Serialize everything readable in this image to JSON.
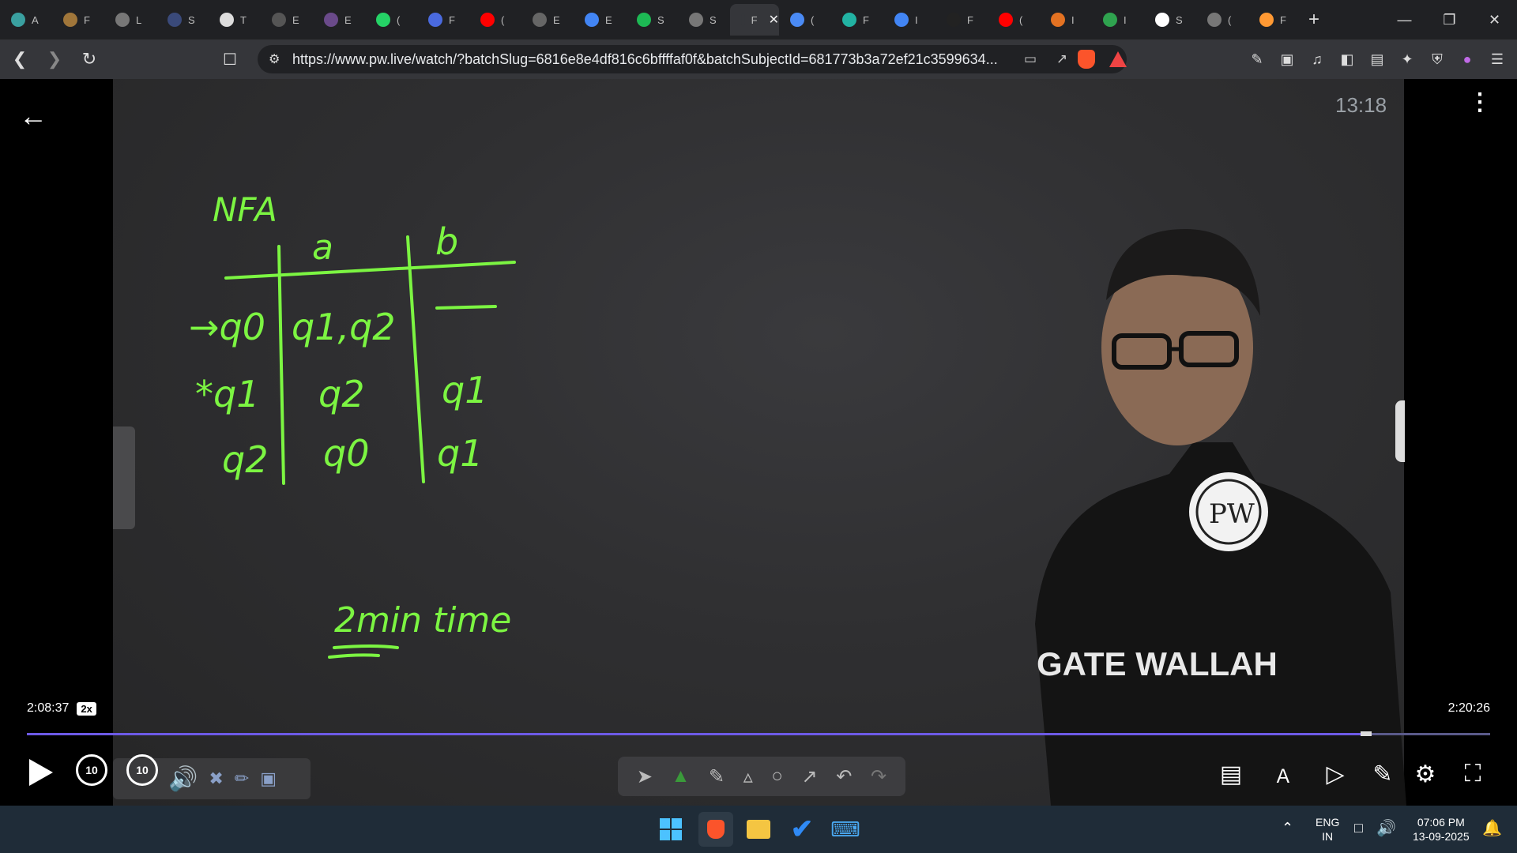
{
  "browser": {
    "tabs": [
      {
        "initial": "A",
        "icon": "copilot-icon",
        "color": "#3aa0a0"
      },
      {
        "initial": "F",
        "icon": "feed-icon",
        "color": "#a0763a"
      },
      {
        "initial": "L",
        "icon": "globe-icon",
        "color": "#777"
      },
      {
        "initial": "S",
        "icon": "site-icon",
        "color": "#3a4a7a"
      },
      {
        "initial": "T",
        "icon": "wix-icon",
        "color": "#ddd"
      },
      {
        "initial": "E",
        "icon": "site-icon",
        "color": "#555"
      },
      {
        "initial": "E",
        "icon": "site-icon",
        "color": "#6a4a8a"
      },
      {
        "initial": "(",
        "icon": "whatsapp-icon",
        "color": "#25d366"
      },
      {
        "initial": "F",
        "icon": "bookmark-app-icon",
        "color": "#4a6adf"
      },
      {
        "initial": "(",
        "icon": "youtube-icon",
        "color": "#ff0000"
      },
      {
        "initial": "E",
        "icon": "site-icon",
        "color": "#666"
      },
      {
        "initial": "E",
        "icon": "google-icon",
        "color": "#4285f4"
      },
      {
        "initial": "S",
        "icon": "spotify-icon",
        "color": "#1db954"
      },
      {
        "initial": "S",
        "icon": "globe-icon",
        "color": "#777"
      },
      {
        "initial": "F",
        "icon": "pw-icon",
        "color": "#35363a",
        "active": true
      },
      {
        "initial": "(",
        "icon": "gemini-icon",
        "color": "#4a8af4"
      },
      {
        "initial": "F",
        "icon": "pw-skills-icon",
        "color": "#22b3a3"
      },
      {
        "initial": "I",
        "icon": "google-icon",
        "color": "#4285f4"
      },
      {
        "initial": "F",
        "icon": "screen-icon",
        "color": "#222"
      },
      {
        "initial": "(",
        "icon": "youtube-icon",
        "color": "#ff0000"
      },
      {
        "initial": "I",
        "icon": "burger-icon",
        "color": "#e37222"
      },
      {
        "initial": "I",
        "icon": "sheet-icon",
        "color": "#2fa34f"
      },
      {
        "initial": "S",
        "icon": "wikipedia-icon",
        "color": "#fff"
      },
      {
        "initial": "(",
        "icon": "globe-icon",
        "color": "#777"
      },
      {
        "initial": "F",
        "icon": "india-flag-icon",
        "color": "#ff9933"
      }
    ],
    "url": "https://www.pw.live/watch/?batchSlug=6816e8e4df816c6bffffaf0f&batchSubjectId=681773b3a72ef21c3599634..."
  },
  "video": {
    "overlay_clock": "13:18",
    "current_time": "2:08:37",
    "speed": "2x",
    "duration": "2:20:26",
    "progress_fraction": 0.915,
    "skip_back": "10",
    "skip_forward": "10"
  },
  "board": {
    "title": "NFA",
    "headers": [
      "a",
      "b"
    ],
    "rows": [
      {
        "state": "→q0",
        "a": "q1,q2",
        "b": "—"
      },
      {
        "state": "*q1",
        "a": "q2",
        "b": "q1"
      },
      {
        "state": "q2",
        "a": "q0",
        "b": "q1"
      }
    ],
    "note": "2min time",
    "shirt_text": "GATE WALLAH",
    "logo_text": "PW"
  },
  "taskbar": {
    "lang_line1": "ENG",
    "lang_line2": "IN",
    "time": "07:06 PM",
    "date": "13-09-2025"
  },
  "colors": {
    "ink": "#7cf542",
    "progress": "#6d5ae6",
    "taskbar": "#1f2c38"
  }
}
